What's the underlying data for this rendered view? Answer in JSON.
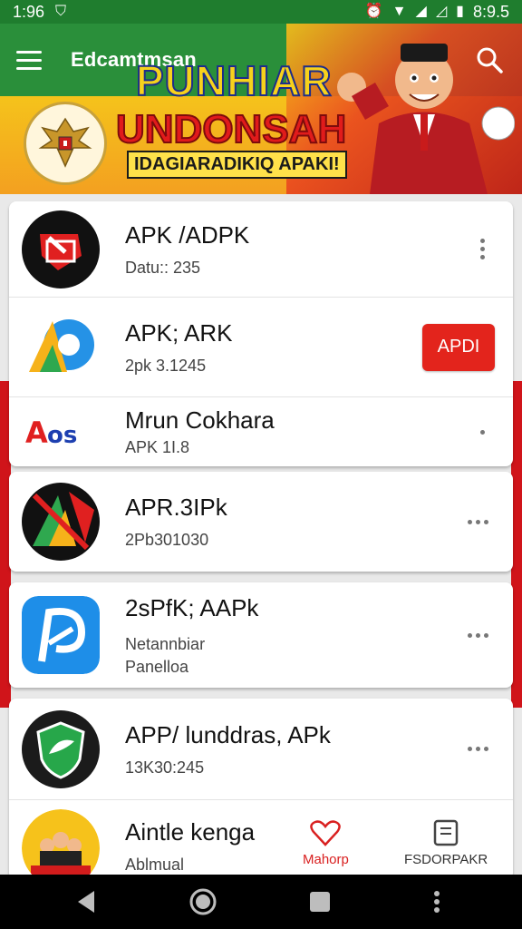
{
  "status_bar": {
    "time": "1:96",
    "clock": "8:9.5"
  },
  "header": {
    "title": "Edcamtmsan",
    "banner_line1": "PUNHIAR",
    "banner_line2": "UNDONSAH",
    "banner_line3": "IDAGIARADIKIQ APAKI!"
  },
  "apps": [
    {
      "name": "APK /ADPK",
      "meta": "Datu:: 235"
    },
    {
      "name": "APK; ARK",
      "meta": "2pk 3.1245",
      "action": "APDI"
    },
    {
      "name": "Mrun Cokhara",
      "meta": "APK 1I.8"
    },
    {
      "name": "APR.3IPk",
      "meta": "2Pb301030"
    },
    {
      "name": "2sPfK; AAPk",
      "meta": "Netannbiar",
      "meta2": "Panelloa"
    },
    {
      "name": "APP/ lunddras, APk",
      "meta": "13K30:245"
    },
    {
      "name": "Aintle kenga",
      "meta": "Ablmual"
    }
  ],
  "tabs": {
    "first": "Mahorp",
    "second": "FSDORPAKR"
  },
  "colors": {
    "green": "#2a8f3a",
    "red": "#e3241c",
    "yellow": "#f5c31b"
  }
}
